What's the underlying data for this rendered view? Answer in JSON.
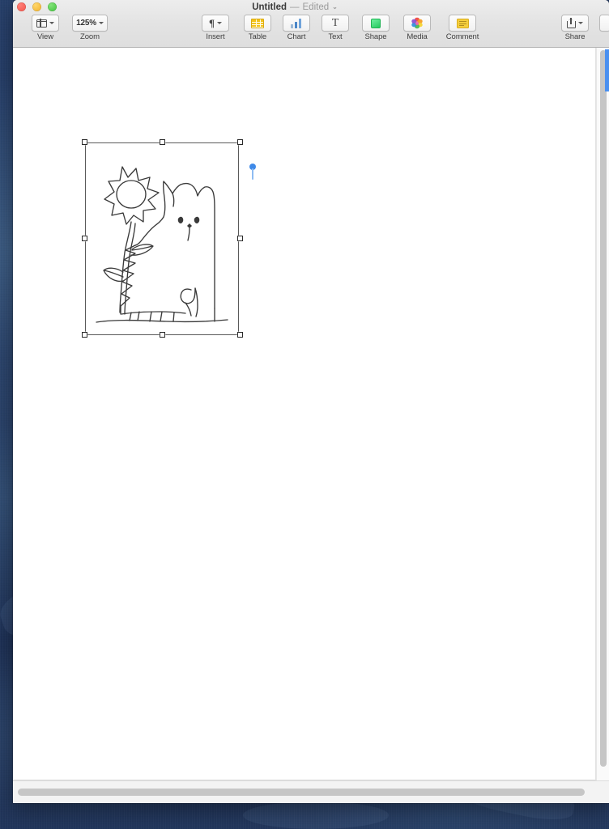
{
  "window": {
    "title": "Untitled",
    "separator": "—",
    "edited_label": "Edited",
    "title_chevron": "⌄",
    "traffic_lights": [
      "close-button",
      "minimize-button",
      "zoom-button"
    ]
  },
  "toolbar": {
    "left_group": [
      {
        "label": "View",
        "icon": "view-sidebar-icon",
        "has_menu": true
      },
      {
        "label": "Zoom",
        "icon": "zoom-level-icon",
        "value": "125%",
        "has_menu": true
      }
    ],
    "middle_group": [
      {
        "label": "Insert",
        "icon": "pilcrow-icon",
        "has_menu": true
      },
      {
        "label": "Table",
        "icon": "table-icon",
        "has_menu": false
      },
      {
        "label": "Chart",
        "icon": "chart-bars-icon",
        "has_menu": false
      },
      {
        "label": "Text",
        "icon": "text-box-icon",
        "has_menu": false
      },
      {
        "label": "Shape",
        "icon": "shape-square-icon",
        "has_menu": false
      },
      {
        "label": "Media",
        "icon": "media-photos-icon",
        "has_menu": false
      },
      {
        "label": "Comment",
        "icon": "comment-note-icon",
        "has_menu": false
      }
    ],
    "right_group": [
      {
        "label": "Share",
        "icon": "share-upload-icon",
        "has_menu": true
      }
    ]
  },
  "document": {
    "zoom_level": "125%",
    "selected_object": {
      "name": "hand-drawn-sketch-cat-and-sunflower",
      "description": "Hand-drawn pencil sketch of a standing cat beside a tall sunflower on a ground line",
      "selected": true,
      "handle_count": 8,
      "anchor_marker": "object-anchor-pin"
    }
  },
  "scrollbars": {
    "vertical": "vertical-scrollbar",
    "horizontal": "horizontal-scrollbar"
  },
  "colors": {
    "accent_blue": "#3f8ae8",
    "panel_edge_blue": "#4a90f0",
    "toolbar_bg": "#e6e6e6",
    "page_bg": "#ffffff",
    "desktop_bg": "#223760"
  }
}
